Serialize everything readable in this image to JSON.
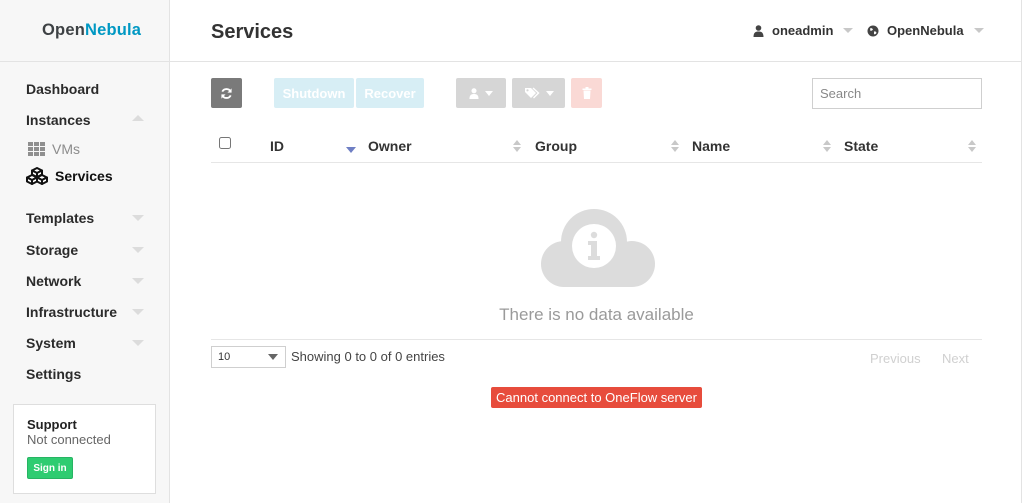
{
  "brand": {
    "open": "Open",
    "nebula": "Nebula"
  },
  "sidebar": {
    "items": [
      {
        "label": "Dashboard"
      },
      {
        "label": "Instances"
      },
      {
        "label": "Templates"
      },
      {
        "label": "Storage"
      },
      {
        "label": "Network"
      },
      {
        "label": "Infrastructure"
      },
      {
        "label": "System"
      },
      {
        "label": "Settings"
      }
    ],
    "subitems": [
      {
        "label": "VMs",
        "icon": "vms-grid-icon"
      },
      {
        "label": "Services",
        "icon": "services-cubes-icon"
      }
    ]
  },
  "support": {
    "title": "Support",
    "status": "Not connected",
    "signin_label": "Sign in"
  },
  "header": {
    "title": "Services",
    "user": "oneadmin",
    "zone": "OpenNebula"
  },
  "toolbar": {
    "shutdown_label": "Shutdown",
    "recover_label": "Recover",
    "search_placeholder": "Search"
  },
  "table": {
    "columns": [
      "ID",
      "Owner",
      "Group",
      "Name",
      "State"
    ],
    "empty_message": "There is no data available",
    "page_length": "10",
    "info": "Showing 0 to 0 of 0 entries",
    "previous_label": "Previous",
    "next_label": "Next"
  },
  "error": {
    "message": "Cannot connect to OneFlow server"
  },
  "colors": {
    "brand_blue": "#0098c3",
    "error_red": "#e74c3c",
    "signin_green": "#2ecc71",
    "disabled_blue": "#d7eef5",
    "disabled_red": "#fad9d5"
  }
}
